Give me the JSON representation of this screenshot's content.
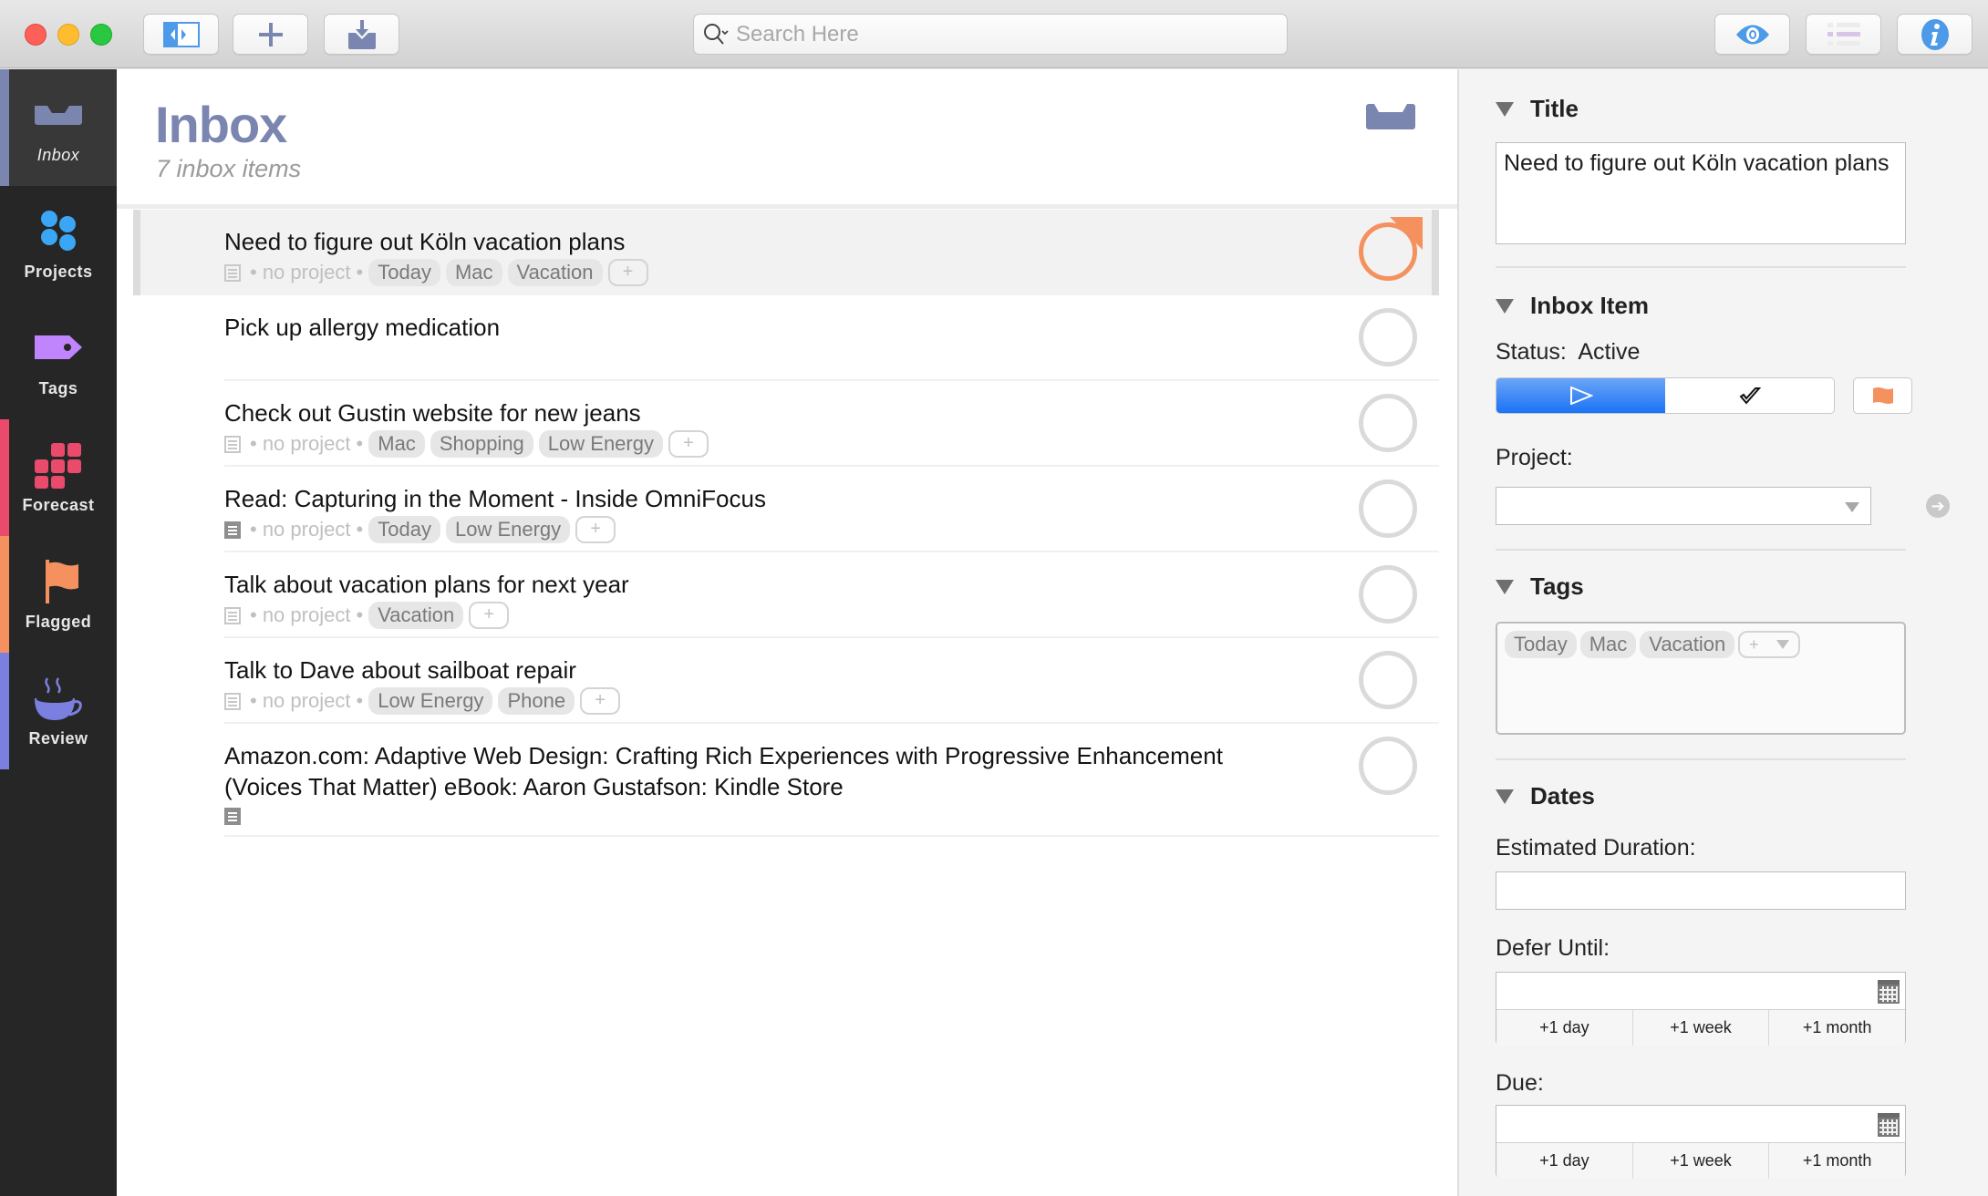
{
  "window": {
    "search_placeholder": "Search Here"
  },
  "toolbar": {
    "buttons": [
      {
        "name": "toggle-sidebar",
        "icon": "sidebar-toggle-icon"
      },
      {
        "name": "new-item",
        "icon": "plus-icon"
      },
      {
        "name": "quick-entry",
        "icon": "inbox-download-icon"
      },
      {
        "name": "view-options",
        "icon": "eye-icon"
      },
      {
        "name": "outline-view",
        "icon": "list-icon"
      },
      {
        "name": "inspector",
        "icon": "info-icon"
      }
    ]
  },
  "sidebar": {
    "items": [
      {
        "label": "Inbox",
        "icon": "inbox-icon",
        "color": "#7b86b0",
        "active": true
      },
      {
        "label": "Projects",
        "icon": "projects-icon",
        "color": "#3ba6f5"
      },
      {
        "label": "Tags",
        "icon": "tag-icon",
        "color": "#c084fc"
      },
      {
        "label": "Forecast",
        "icon": "forecast-icon",
        "color": "#ea4b6c"
      },
      {
        "label": "Flagged",
        "icon": "flag-icon",
        "color": "#f4915f"
      },
      {
        "label": "Review",
        "icon": "coffee-cup-icon",
        "color": "#7b7fe0"
      }
    ]
  },
  "main": {
    "title": "Inbox",
    "subtitle": "7 inbox items",
    "no_project_label": "• no project •",
    "items": [
      {
        "title": "Need to figure out Köln vacation plans",
        "tags": [
          "Today",
          "Mac",
          "Vacation"
        ],
        "has_note": false,
        "flagged": true,
        "selected": true,
        "show_meta": true
      },
      {
        "title": "Pick up allergy medication",
        "tags": [],
        "has_note": false,
        "flagged": false,
        "show_meta": false
      },
      {
        "title": "Check out Gustin website for new jeans",
        "tags": [
          "Mac",
          "Shopping",
          "Low Energy"
        ],
        "has_note": false,
        "flagged": false,
        "show_meta": true
      },
      {
        "title": "Read: Capturing in the Moment - Inside OmniFocus",
        "tags": [
          "Today",
          "Low Energy"
        ],
        "has_note": true,
        "flagged": false,
        "show_meta": true
      },
      {
        "title": "Talk about vacation plans for next year",
        "tags": [
          "Vacation"
        ],
        "has_note": false,
        "flagged": false,
        "show_meta": true
      },
      {
        "title": "Talk to Dave about sailboat repair",
        "tags": [
          "Low Energy",
          "Phone"
        ],
        "has_note": false,
        "flagged": false,
        "show_meta": true
      },
      {
        "title": "Amazon.com: Adaptive Web Design: Crafting Rich Experiences with Progressive Enhancement (Voices That Matter) eBook: Aaron Gustafson: Kindle Store",
        "tags": [],
        "has_note": true,
        "flagged": false,
        "show_meta": false
      }
    ],
    "add_tag_label": "+"
  },
  "inspector": {
    "title_section": {
      "heading": "Title",
      "value": "Need to figure out Köln vacation plans"
    },
    "inbox_section": {
      "heading": "Inbox Item",
      "status_label": "Status:",
      "status_value": "Active",
      "project_label": "Project:",
      "project_value": ""
    },
    "tags_section": {
      "heading": "Tags",
      "tags": [
        "Today",
        "Mac",
        "Vacation"
      ],
      "add_label": "+"
    },
    "dates_section": {
      "heading": "Dates",
      "duration_label": "Estimated Duration:",
      "duration_value": "",
      "defer_label": "Defer Until:",
      "defer_value": "",
      "due_label": "Due:",
      "due_value": "",
      "quick_buttons": [
        "+1 day",
        "+1 week",
        "+1 month"
      ]
    }
  },
  "colors": {
    "accent_blue": "#1b73f5",
    "flag_orange": "#f4915f",
    "inbox_purple": "#7b86b0"
  }
}
